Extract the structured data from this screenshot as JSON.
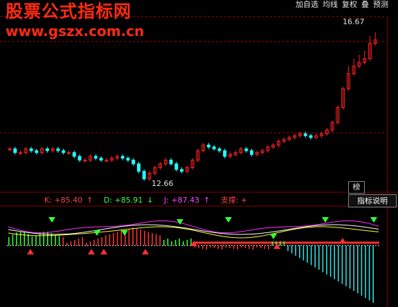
{
  "watermark": {
    "title": "股票公式指标网",
    "url": "www.gszx.com.cn"
  },
  "toolbar": {
    "items": [
      "加自选",
      "均线",
      "复权",
      "叠",
      "预测"
    ]
  },
  "price_chart": {
    "high_label": "16.67",
    "low_label": "12.66",
    "up_color": "#ff2222",
    "down_color": "#22ffff",
    "dashed_line_color": "#b00000"
  },
  "indicator": {
    "k_label": "K: +85.40",
    "k_arrow": "↑",
    "d_label": "D: +85.91",
    "d_arrow": "↓",
    "j_label": "J: +87.43",
    "j_arrow": "↑",
    "support_label": "支撑: +"
  },
  "buttons": {
    "bang": "榜",
    "indicator_desc": "指标说明"
  },
  "chart_data": {
    "type": "candlestick",
    "close_series": [
      13.5,
      13.4,
      13.4,
      13.5,
      13.45,
      13.4,
      13.5,
      13.45,
      13.5,
      13.45,
      13.4,
      13.4,
      13.3,
      13.2,
      13.2,
      13.3,
      13.25,
      13.2,
      13.2,
      13.25,
      13.3,
      13.25,
      13.2,
      13.1,
      12.9,
      12.7,
      12.85,
      13.0,
      13.1,
      13.2,
      13.1,
      12.95,
      12.9,
      13.0,
      13.2,
      13.45,
      13.6,
      13.55,
      13.5,
      13.45,
      13.3,
      13.35,
      13.4,
      13.5,
      13.45,
      13.35,
      13.4,
      13.45,
      13.55,
      13.6,
      13.7,
      13.75,
      13.8,
      13.85,
      13.9,
      13.85,
      13.8,
      13.85,
      13.9,
      14.0,
      14.2,
      14.6,
      15.1,
      15.5,
      15.7,
      15.8,
      15.9,
      16.3,
      16.4
    ],
    "high": 16.67,
    "low": 12.66
  }
}
